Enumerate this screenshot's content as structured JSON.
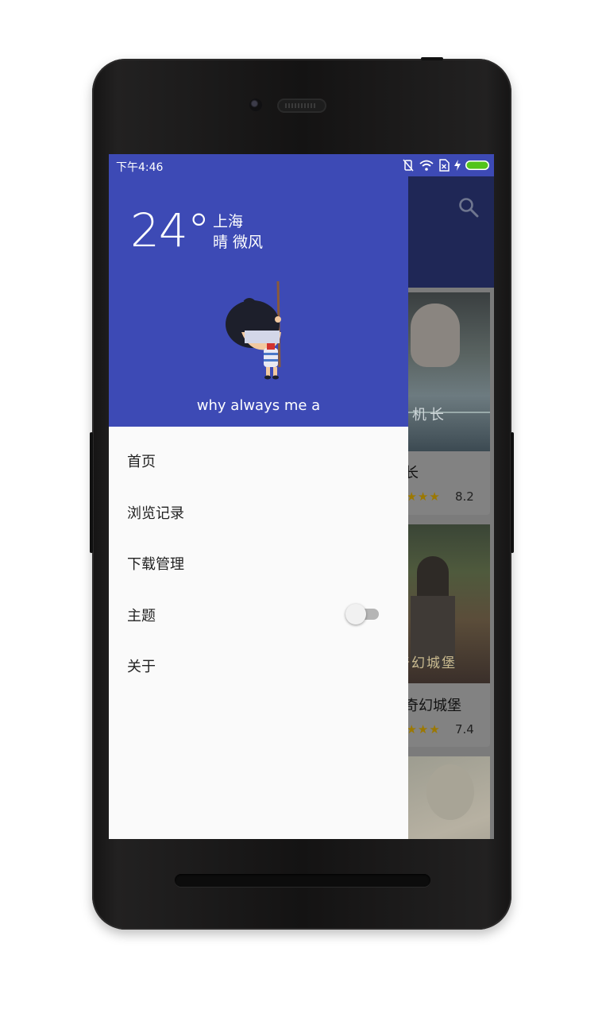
{
  "status_bar": {
    "time": "下午4:46"
  },
  "weather": {
    "temperature": "24°",
    "city": "上海",
    "description": "晴 微风"
  },
  "user": {
    "name": "why always me a"
  },
  "menu": [
    {
      "label": "首页"
    },
    {
      "label": "浏览记录"
    },
    {
      "label": "下载管理"
    },
    {
      "label": "主题",
      "toggle": false
    },
    {
      "label": "关于"
    }
  ],
  "background_list": {
    "items": [
      {
        "title": "萨利机长",
        "rating": "8.2",
        "stars": "★★★★",
        "poster_text": "萨利机长"
      },
      {
        "title": "佩小姐的奇幻城堡",
        "rating": "7.4",
        "stars": "★★★★",
        "poster_text": "奇幻城堡"
      }
    ]
  },
  "colors": {
    "primary": "#3d4ab5",
    "drawer_bg": "#fafafa",
    "switch_off": "#b5b5b5"
  }
}
